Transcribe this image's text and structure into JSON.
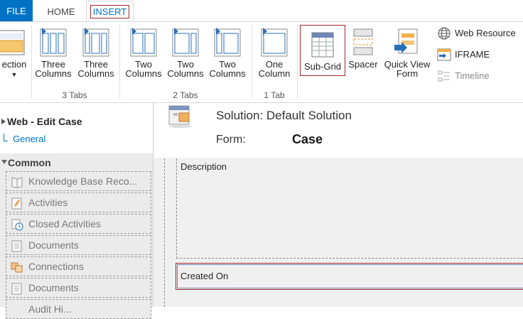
{
  "tabs": {
    "file": "FILE",
    "home": "HOME",
    "insert": "INSERT"
  },
  "ribbon": {
    "section_partial": "ection",
    "buttons": {
      "three_col_1": [
        "Three",
        "Columns"
      ],
      "three_col_2": [
        "Three",
        "Columns"
      ],
      "two_col_1": [
        "Two",
        "Columns"
      ],
      "two_col_2": [
        "Two",
        "Columns"
      ],
      "two_col_3": [
        "Two",
        "Columns"
      ],
      "one_col": [
        "One",
        "Column"
      ],
      "sub_grid": "Sub-Grid",
      "spacer": "Spacer",
      "quick_view": [
        "Quick View",
        "Form"
      ],
      "web_resource": "Web Resource",
      "iframe": "IFRAME",
      "timeline": "Timeline"
    },
    "groups": {
      "three_tabs": "3 Tabs",
      "two_tabs": "2 Tabs",
      "one_tab": "1 Tab"
    }
  },
  "nav": {
    "title": "Web - Edit Case",
    "general": "General",
    "group": "Common",
    "items": [
      "Knowledge Base Reco...",
      "Activities",
      "Closed Activities",
      "Documents",
      "Connections",
      "Documents",
      "Audit Hi..."
    ]
  },
  "header": {
    "solution": "Solution: Default Solution",
    "form_label": "Form:",
    "form_value": "Case"
  },
  "fields": {
    "description": "Description",
    "created_on": "Created On"
  },
  "colors": {
    "accent": "#0072c6",
    "highlight": "#a4262c"
  }
}
